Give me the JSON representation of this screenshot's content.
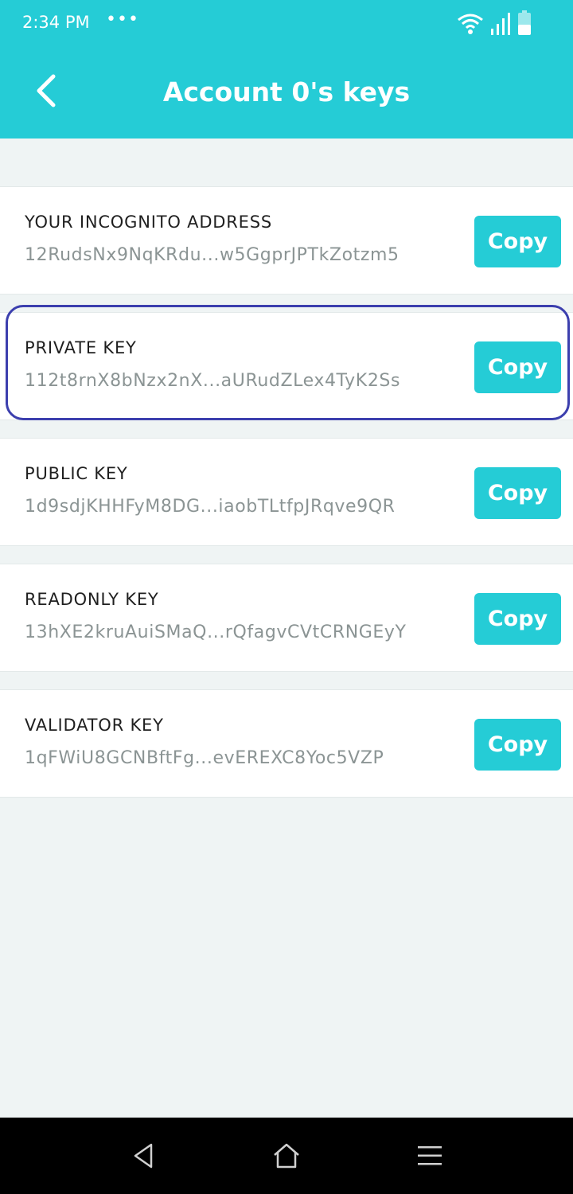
{
  "status_bar": {
    "time": "2:34 PM",
    "dots": "•••",
    "icons": [
      "wifi-icon",
      "signal-icon",
      "battery-icon"
    ]
  },
  "header": {
    "title": "Account 0's keys",
    "back_icon": "chevron-left-icon"
  },
  "keys": [
    {
      "label": "YOUR INCOGNITO ADDRESS",
      "value": "12RudsNx9NqKRdu...w5GgprJPTkZotzm5",
      "button": "Copy"
    },
    {
      "label": "PRIVATE KEY",
      "value": "112t8rnX8bNzx2nX...aURudZLex4TyK2Ss",
      "button": "Copy"
    },
    {
      "label": "PUBLIC KEY",
      "value": "1d9sdjKHHFyM8DG...iaobTLtfpJRqve9QR",
      "button": "Copy"
    },
    {
      "label": "READONLY KEY",
      "value": "13hXE2kruAuiSMaQ...rQfagvCVtCRNGEyY",
      "button": "Copy"
    },
    {
      "label": "VALIDATOR KEY",
      "value": "1qFWiU8GCNBftFg...evEREXC8Yoc5VZP",
      "button": "Copy"
    }
  ],
  "nav_bar": {
    "icons": [
      "nav-back-icon",
      "home-icon",
      "menu-icon"
    ]
  },
  "colors": {
    "accent": "#25ccd6",
    "focus_ring": "#3c3fae",
    "background": "#eff4f4"
  }
}
